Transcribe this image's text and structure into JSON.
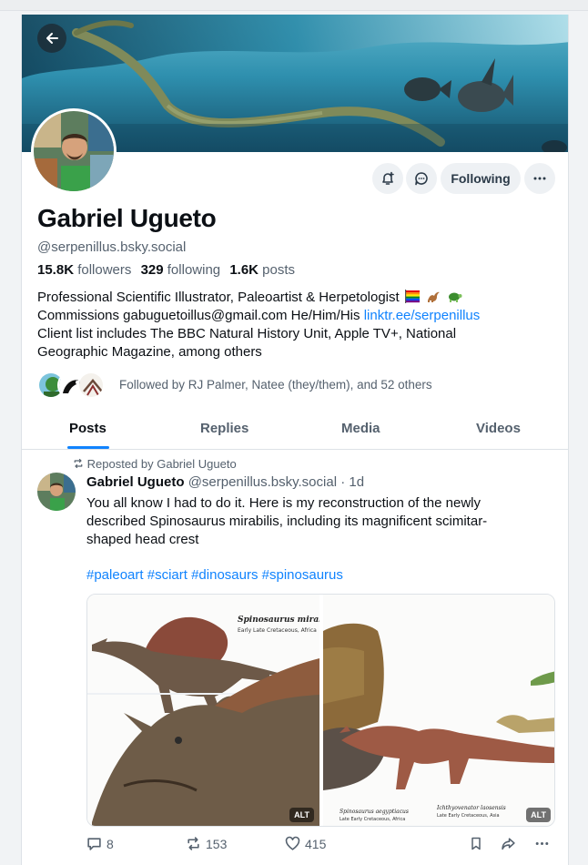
{
  "profile": {
    "name": "Gabriel Ugueto",
    "handle": "@serpenillus.bsky.social",
    "followers_count": "15.8K",
    "followers_label": "followers",
    "following_count": "329",
    "following_label": "following",
    "posts_count": "1.6K",
    "posts_label": "posts",
    "bio_line1": "Professional Scientific Illustrator, Paleoartist & Herpetologist",
    "bio_line2_prefix": "Commissions gabuguetoillus@gmail.com He/Him/His",
    "bio_link": "linktr.ee/serpenillus",
    "bio_line3": "Client list includes The BBC Natural History Unit, Apple TV+, National",
    "bio_line4": "Geographic Magazine, among others",
    "followed_by": "Followed by RJ Palmer, Natee (they/them), and 52 others",
    "bio_emoji_icons": [
      "rainbow-flag-icon",
      "dinosaur-icon",
      "turtle-icon"
    ]
  },
  "actions": {
    "follow_label": "Following",
    "back_icon": "arrow-left-icon",
    "notify_icon": "bell-plus-icon",
    "message_icon": "chat-bubble-icon",
    "more_icon": "ellipsis-icon"
  },
  "tabs": [
    {
      "label": "Posts",
      "active": true
    },
    {
      "label": "Replies"
    },
    {
      "label": "Media"
    },
    {
      "label": "Videos"
    }
  ],
  "post": {
    "repost_label": "Reposted by Gabriel Ugueto",
    "author_name": "Gabriel Ugueto",
    "author_handle": "@serpenillus.bsky.social",
    "separator": "·",
    "time": "1d",
    "text_line1": "You all know I had to do it. Here is my reconstruction of the newly",
    "text_line2": "described Spinosaurus mirabilis, including its magnificent scimitar-",
    "text_line3": "shaped head crest",
    "hashtags": [
      "#paleoart",
      "#sciart",
      "#dinosaurs",
      "#spinosaurus"
    ],
    "images": [
      {
        "alt_badge": "ALT",
        "caption_title": "Spinosaurus mirabilis",
        "caption_sub": "Early Late Cretaceous, Africa"
      },
      {
        "alt_badge": "ALT",
        "caption_left_title": "Spinosaurus aegyptiacus",
        "caption_left_sub": "Late Early Cretaceous, Africa",
        "caption_right_title": "Ichthyovenator laosensis",
        "caption_right_sub": "Late Early Cretaceous, Asia"
      }
    ],
    "reply_count": "8",
    "repost_count": "153",
    "like_count": "415"
  },
  "colors": {
    "accent": "#1083fe",
    "muted": "#55616e",
    "button_bg": "#eef1f4"
  }
}
